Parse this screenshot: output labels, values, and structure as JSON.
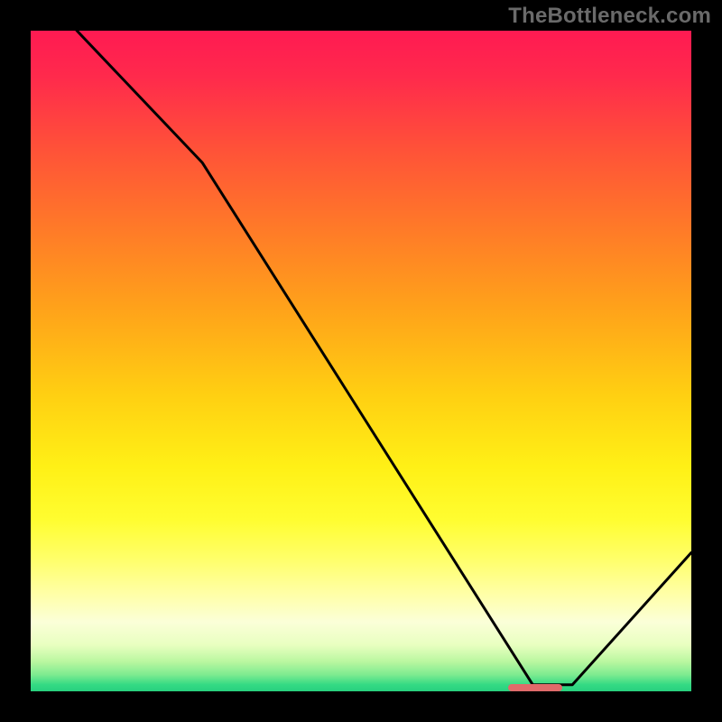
{
  "watermark": "TheBottleneck.com",
  "gradient_stops": [
    {
      "offset": 0.0,
      "color": "#ff1a52"
    },
    {
      "offset": 0.07,
      "color": "#ff2a4c"
    },
    {
      "offset": 0.18,
      "color": "#ff5238"
    },
    {
      "offset": 0.3,
      "color": "#ff7a28"
    },
    {
      "offset": 0.42,
      "color": "#ffa21a"
    },
    {
      "offset": 0.55,
      "color": "#ffcf12"
    },
    {
      "offset": 0.66,
      "color": "#fff016"
    },
    {
      "offset": 0.74,
      "color": "#fffd30"
    },
    {
      "offset": 0.8,
      "color": "#ffff6a"
    },
    {
      "offset": 0.85,
      "color": "#ffffa4"
    },
    {
      "offset": 0.895,
      "color": "#fbffd8"
    },
    {
      "offset": 0.93,
      "color": "#e8ffc0"
    },
    {
      "offset": 0.955,
      "color": "#baf7a0"
    },
    {
      "offset": 0.975,
      "color": "#7deb90"
    },
    {
      "offset": 0.99,
      "color": "#34da84"
    },
    {
      "offset": 1.0,
      "color": "#28d07e"
    }
  ],
  "marker": {
    "x_start_frac": 0.722,
    "x_end_frac": 0.805,
    "color": "#e06a6a"
  },
  "chart_data": {
    "type": "line",
    "title": "",
    "xlabel": "",
    "ylabel": "",
    "xlim": [
      0,
      100
    ],
    "ylim": [
      0,
      100
    ],
    "x": [
      0,
      7,
      26,
      76,
      82,
      100
    ],
    "values": [
      110,
      100,
      80,
      1,
      1,
      21
    ],
    "note": "y-values are bottleneck percentages; the curve descends from >100% at x≈0 to ~0% near x≈76–82 then rises to ~21% at x=100. x represents a configuration sweep (implied by source site)."
  }
}
